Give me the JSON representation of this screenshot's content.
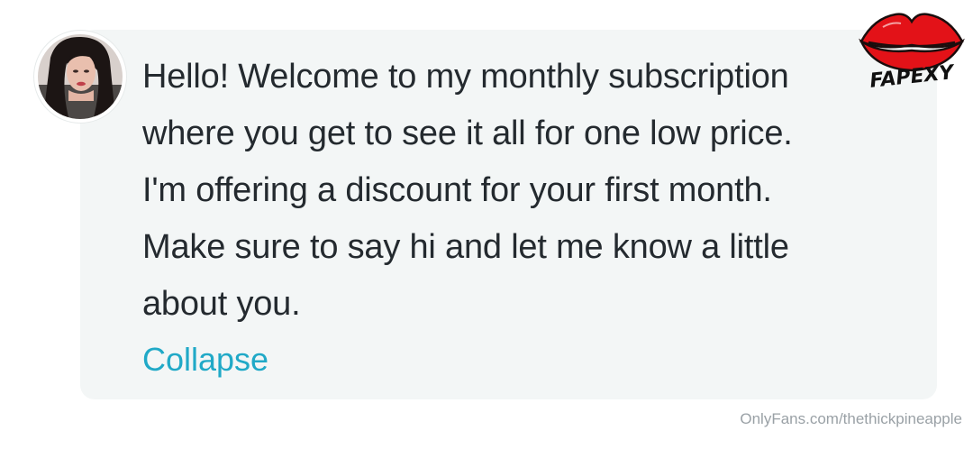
{
  "post": {
    "message_lines": [
      "Hello! Welcome to my monthly subscription",
      "where you get to see it all for one low price.",
      "I'm offering a discount for your first month.",
      "Make sure to say hi and let me know a little",
      "about you."
    ],
    "collapse_label": "Collapse"
  },
  "watermark": {
    "text": "OnlyFans.com/thethickpineapple"
  },
  "logo": {
    "text": "FAPEXY",
    "icon": "lips-icon",
    "color": "#e31218"
  },
  "colors": {
    "bubble_background": "#f3f6f6",
    "text": "#242a2f",
    "link": "#20a9c7",
    "watermark": "#9aa1a6"
  }
}
